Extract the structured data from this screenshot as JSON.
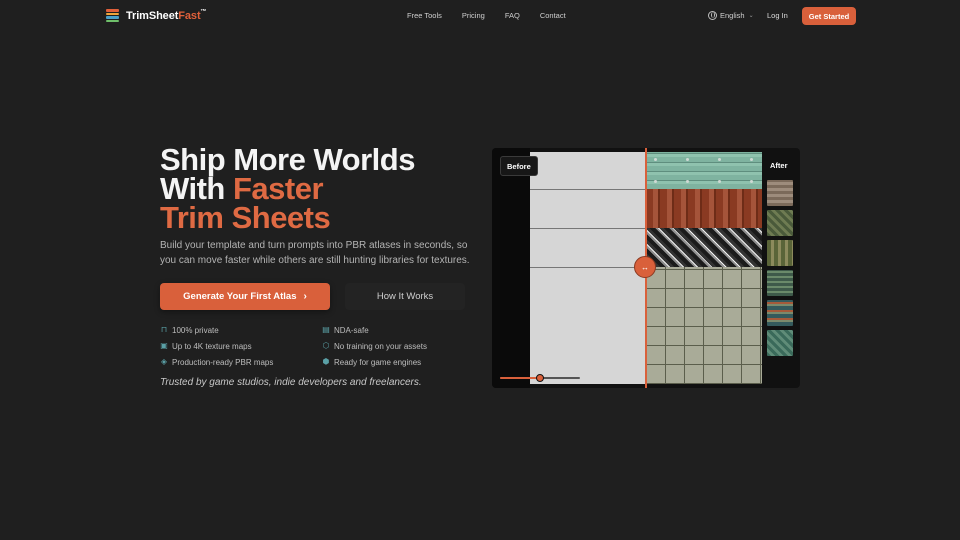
{
  "brand": {
    "name_primary": "TrimSheet",
    "name_accent": "Fast",
    "trademark": "™",
    "logo_colors": [
      "#e0603a",
      "#f0a53a",
      "#4aa0c8",
      "#6fbf6a"
    ]
  },
  "nav": {
    "items": [
      {
        "label": "Free Tools"
      },
      {
        "label": "Pricing"
      },
      {
        "label": "FAQ"
      },
      {
        "label": "Contact"
      }
    ],
    "language": "English",
    "login": "Log In",
    "cta": "Get Started"
  },
  "hero": {
    "title_line1": "Ship More Worlds",
    "title_line2_prefix": "With ",
    "title_line2_accent": "Faster",
    "title_line3_accent": "Trim Sheets",
    "subtitle": "Build your template and turn prompts into PBR atlases in seconds, so you can move faster while others are still hunting libraries for textures.",
    "primary_button": "Generate Your First Atlas",
    "secondary_button": "How It Works",
    "features": [
      {
        "icon": "lock-icon",
        "glyph": "⊓",
        "label": "100% private"
      },
      {
        "icon": "document-icon",
        "glyph": "▤",
        "label": "NDA-safe"
      },
      {
        "icon": "image-icon",
        "glyph": "▣",
        "label": "Up to 4K texture maps"
      },
      {
        "icon": "shield-icon",
        "glyph": "⬡",
        "label": "No training on your assets"
      },
      {
        "icon": "layers-icon",
        "glyph": "◈",
        "label": "Production-ready PBR maps"
      },
      {
        "icon": "cube-icon",
        "glyph": "⬢",
        "label": "Ready for game engines"
      }
    ],
    "trusted": "Trusted by game studios, indie developers and freelancers."
  },
  "preview": {
    "before_label": "Before",
    "after_label": "After",
    "handle_glyph": "↔",
    "zoom_slider_value": 0.5,
    "accent": "#d9603b"
  }
}
